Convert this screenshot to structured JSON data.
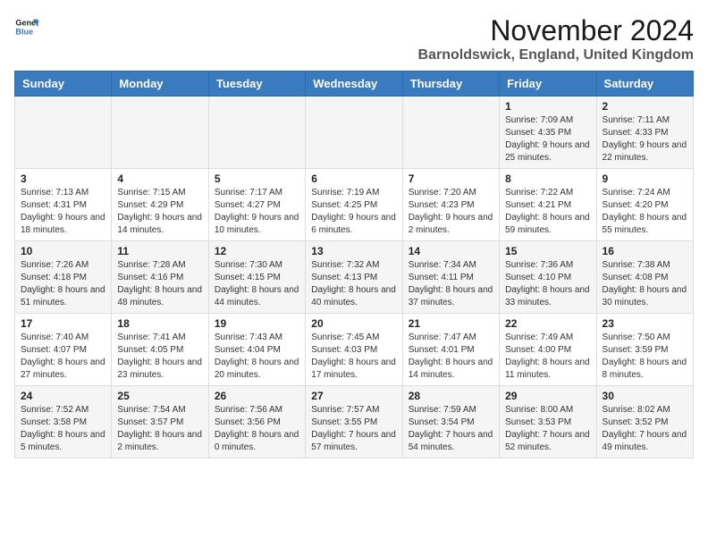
{
  "logo": {
    "line1": "General",
    "line2": "Blue"
  },
  "title": "November 2024",
  "subtitle": "Barnoldswick, England, United Kingdom",
  "days_of_week": [
    "Sunday",
    "Monday",
    "Tuesday",
    "Wednesday",
    "Thursday",
    "Friday",
    "Saturday"
  ],
  "weeks": [
    [
      {
        "day": "",
        "info": ""
      },
      {
        "day": "",
        "info": ""
      },
      {
        "day": "",
        "info": ""
      },
      {
        "day": "",
        "info": ""
      },
      {
        "day": "",
        "info": ""
      },
      {
        "day": "1",
        "info": "Sunrise: 7:09 AM\nSunset: 4:35 PM\nDaylight: 9 hours and 25 minutes."
      },
      {
        "day": "2",
        "info": "Sunrise: 7:11 AM\nSunset: 4:33 PM\nDaylight: 9 hours and 22 minutes."
      }
    ],
    [
      {
        "day": "3",
        "info": "Sunrise: 7:13 AM\nSunset: 4:31 PM\nDaylight: 9 hours and 18 minutes."
      },
      {
        "day": "4",
        "info": "Sunrise: 7:15 AM\nSunset: 4:29 PM\nDaylight: 9 hours and 14 minutes."
      },
      {
        "day": "5",
        "info": "Sunrise: 7:17 AM\nSunset: 4:27 PM\nDaylight: 9 hours and 10 minutes."
      },
      {
        "day": "6",
        "info": "Sunrise: 7:19 AM\nSunset: 4:25 PM\nDaylight: 9 hours and 6 minutes."
      },
      {
        "day": "7",
        "info": "Sunrise: 7:20 AM\nSunset: 4:23 PM\nDaylight: 9 hours and 2 minutes."
      },
      {
        "day": "8",
        "info": "Sunrise: 7:22 AM\nSunset: 4:21 PM\nDaylight: 8 hours and 59 minutes."
      },
      {
        "day": "9",
        "info": "Sunrise: 7:24 AM\nSunset: 4:20 PM\nDaylight: 8 hours and 55 minutes."
      }
    ],
    [
      {
        "day": "10",
        "info": "Sunrise: 7:26 AM\nSunset: 4:18 PM\nDaylight: 8 hours and 51 minutes."
      },
      {
        "day": "11",
        "info": "Sunrise: 7:28 AM\nSunset: 4:16 PM\nDaylight: 8 hours and 48 minutes."
      },
      {
        "day": "12",
        "info": "Sunrise: 7:30 AM\nSunset: 4:15 PM\nDaylight: 8 hours and 44 minutes."
      },
      {
        "day": "13",
        "info": "Sunrise: 7:32 AM\nSunset: 4:13 PM\nDaylight: 8 hours and 40 minutes."
      },
      {
        "day": "14",
        "info": "Sunrise: 7:34 AM\nSunset: 4:11 PM\nDaylight: 8 hours and 37 minutes."
      },
      {
        "day": "15",
        "info": "Sunrise: 7:36 AM\nSunset: 4:10 PM\nDaylight: 8 hours and 33 minutes."
      },
      {
        "day": "16",
        "info": "Sunrise: 7:38 AM\nSunset: 4:08 PM\nDaylight: 8 hours and 30 minutes."
      }
    ],
    [
      {
        "day": "17",
        "info": "Sunrise: 7:40 AM\nSunset: 4:07 PM\nDaylight: 8 hours and 27 minutes."
      },
      {
        "day": "18",
        "info": "Sunrise: 7:41 AM\nSunset: 4:05 PM\nDaylight: 8 hours and 23 minutes."
      },
      {
        "day": "19",
        "info": "Sunrise: 7:43 AM\nSunset: 4:04 PM\nDaylight: 8 hours and 20 minutes."
      },
      {
        "day": "20",
        "info": "Sunrise: 7:45 AM\nSunset: 4:03 PM\nDaylight: 8 hours and 17 minutes."
      },
      {
        "day": "21",
        "info": "Sunrise: 7:47 AM\nSunset: 4:01 PM\nDaylight: 8 hours and 14 minutes."
      },
      {
        "day": "22",
        "info": "Sunrise: 7:49 AM\nSunset: 4:00 PM\nDaylight: 8 hours and 11 minutes."
      },
      {
        "day": "23",
        "info": "Sunrise: 7:50 AM\nSunset: 3:59 PM\nDaylight: 8 hours and 8 minutes."
      }
    ],
    [
      {
        "day": "24",
        "info": "Sunrise: 7:52 AM\nSunset: 3:58 PM\nDaylight: 8 hours and 5 minutes."
      },
      {
        "day": "25",
        "info": "Sunrise: 7:54 AM\nSunset: 3:57 PM\nDaylight: 8 hours and 2 minutes."
      },
      {
        "day": "26",
        "info": "Sunrise: 7:56 AM\nSunset: 3:56 PM\nDaylight: 8 hours and 0 minutes."
      },
      {
        "day": "27",
        "info": "Sunrise: 7:57 AM\nSunset: 3:55 PM\nDaylight: 7 hours and 57 minutes."
      },
      {
        "day": "28",
        "info": "Sunrise: 7:59 AM\nSunset: 3:54 PM\nDaylight: 7 hours and 54 minutes."
      },
      {
        "day": "29",
        "info": "Sunrise: 8:00 AM\nSunset: 3:53 PM\nDaylight: 7 hours and 52 minutes."
      },
      {
        "day": "30",
        "info": "Sunrise: 8:02 AM\nSunset: 3:52 PM\nDaylight: 7 hours and 49 minutes."
      }
    ]
  ]
}
